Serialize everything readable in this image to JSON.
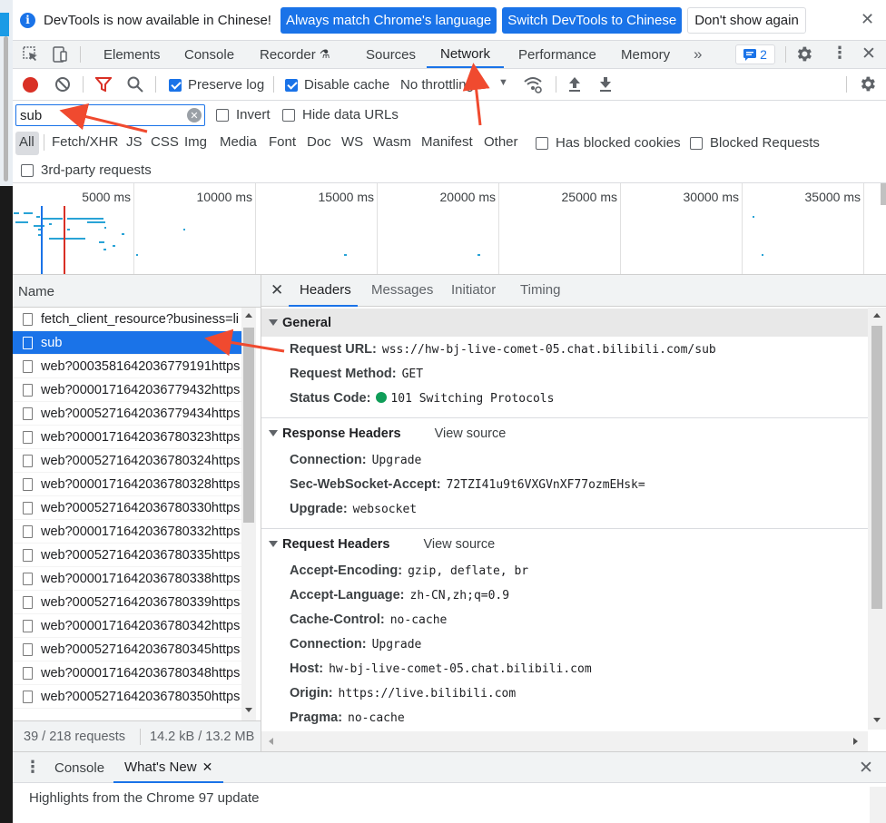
{
  "infobar": {
    "message": "DevTools is now available in Chinese!",
    "btn_match": "Always match Chrome's language",
    "btn_switch": "Switch DevTools to Chinese",
    "btn_dismiss": "Don't show again"
  },
  "tabs": [
    "Elements",
    "Console",
    "Recorder",
    "Sources",
    "Network",
    "Performance",
    "Memory"
  ],
  "issues_count": "2",
  "toolbar": {
    "preserve_log": "Preserve log",
    "disable_cache": "Disable cache",
    "throttling": "No throttling"
  },
  "filter": {
    "value": "sub",
    "invert": "Invert",
    "hide_data_urls": "Hide data URLs"
  },
  "types": [
    "All",
    "Fetch/XHR",
    "JS",
    "CSS",
    "Img",
    "Media",
    "Font",
    "Doc",
    "WS",
    "Wasm",
    "Manifest",
    "Other"
  ],
  "has_blocked_cookies": "Has blocked cookies",
  "blocked_requests": "Blocked Requests",
  "third_party": "3rd-party requests",
  "overview_ticks": [
    "5000 ms",
    "10000 ms",
    "15000 ms",
    "20000 ms",
    "25000 ms",
    "30000 ms",
    "35000 ms"
  ],
  "requests": {
    "header": "Name",
    "items": [
      "fetch_client_resource?business=li",
      "sub",
      "web?000358164203677919​1https",
      "web?000017164203677943​2https",
      "web?000527164203677943​4https",
      "web?000017164203678032​3https",
      "web?000527164203678032​4https",
      "web?000017164203678032​8https",
      "web?000527164203678033​0https",
      "web?000017164203678033​2https",
      "web?000527164203678033​5https",
      "web?000017164203678033​8https",
      "web?000527164203678033​9https",
      "web?000017164203678034​2https",
      "web?000527164203678034​5https",
      "web?000017164203678034​8https",
      "web?000527164203678035​0https"
    ],
    "summary_count": "39 / 218 requests",
    "summary_size": "14.2 kB / 13.2 MB"
  },
  "details": {
    "tabs": [
      "Headers",
      "Messages",
      "Initiator",
      "Timing"
    ],
    "general": {
      "title": "General",
      "request_url_key": "Request URL:",
      "request_url": "wss://hw-bj-live-comet-05.chat.bilibili.com/sub",
      "method_key": "Request Method:",
      "method": "GET",
      "status_key": "Status Code:",
      "status": "101 Switching Protocols"
    },
    "response": {
      "title": "Response Headers",
      "view_source": "View source",
      "headers": [
        {
          "key": "Connection:",
          "value": "Upgrade"
        },
        {
          "key": "Sec-WebSocket-Accept:",
          "value": "72TZI41u9t6VXGVnXF77ozmEHsk="
        },
        {
          "key": "Upgrade:",
          "value": "websocket"
        }
      ]
    },
    "request": {
      "title": "Request Headers",
      "view_source": "View source",
      "headers": [
        {
          "key": "Accept-Encoding:",
          "value": "gzip, deflate, br"
        },
        {
          "key": "Accept-Language:",
          "value": "zh-CN,zh;q=0.9"
        },
        {
          "key": "Cache-Control:",
          "value": "no-cache"
        },
        {
          "key": "Connection:",
          "value": "Upgrade"
        },
        {
          "key": "Host:",
          "value": "hw-bj-live-comet-05.chat.bilibili.com"
        },
        {
          "key": "Origin:",
          "value": "https://live.bilibili.com"
        },
        {
          "key": "Pragma:",
          "value": "no-cache"
        }
      ]
    }
  },
  "drawer": {
    "tab_console": "Console",
    "tab_whats_new": "What's New",
    "highlight": "Highlights from the Chrome 97 update"
  },
  "colors": {
    "accent": "#1a73e8",
    "record_red": "#d93025",
    "status_green": "#0f9d58",
    "annotation_red": "#f04a2f"
  }
}
